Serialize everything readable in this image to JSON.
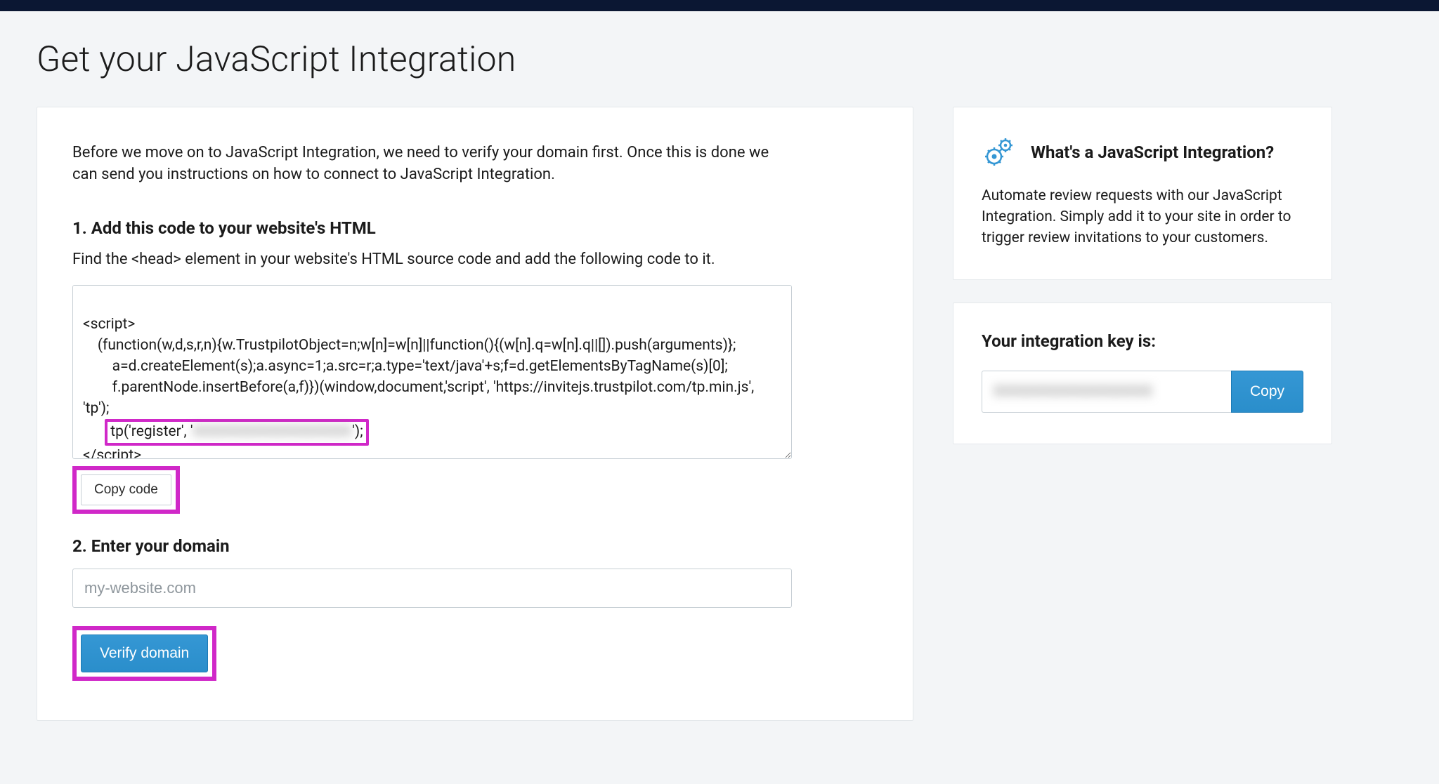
{
  "page": {
    "title": "Get your JavaScript Integration"
  },
  "main": {
    "intro": "Before we move on to JavaScript Integration, we need to verify your domain first. Once this is done we can send you instructions on how to connect to JavaScript Integration.",
    "step1_title": "1. Add this code to your website's HTML",
    "step1_desc": "Find the <head> element in your website's HTML source code and add the following code to it.",
    "code_open": "<script>",
    "code_line1": "    (function(w,d,s,r,n){w.TrustpilotObject=n;w[n]=w[n]||function(){(w[n].q=w[n].q||[]).push(arguments)};",
    "code_line2": "        a=d.createElement(s);a.async=1;a.src=r;a.type='text/java'+s;f=d.getElementsByTagName(s)[0];",
    "code_line3": "        f.parentNode.insertBefore(a,f)})(window,document,'script', 'https://invitejs.trustpilot.com/tp.min.js',",
    "code_line4": "'tp');",
    "code_reg_prefix": "tp('register', '",
    "code_reg_key": "XXXXXXXXXXXXXXXX",
    "code_reg_suffix": "');",
    "code_close": "</scr",
    "code_close2": "ipt>",
    "copy_code_label": "Copy code",
    "step2_title": "2. Enter your domain",
    "domain_placeholder": "my-website.com",
    "verify_label": "Verify domain"
  },
  "side": {
    "info_title": "What's a JavaScript Integration?",
    "info_body": "Automate review requests with our JavaScript Integration. Simply add it to your site in order to trigger review invitations to your customers.",
    "key_label": "Your integration key is:",
    "key_value": "XXXXXXXXXXXXXXXX",
    "copy_label": "Copy"
  }
}
